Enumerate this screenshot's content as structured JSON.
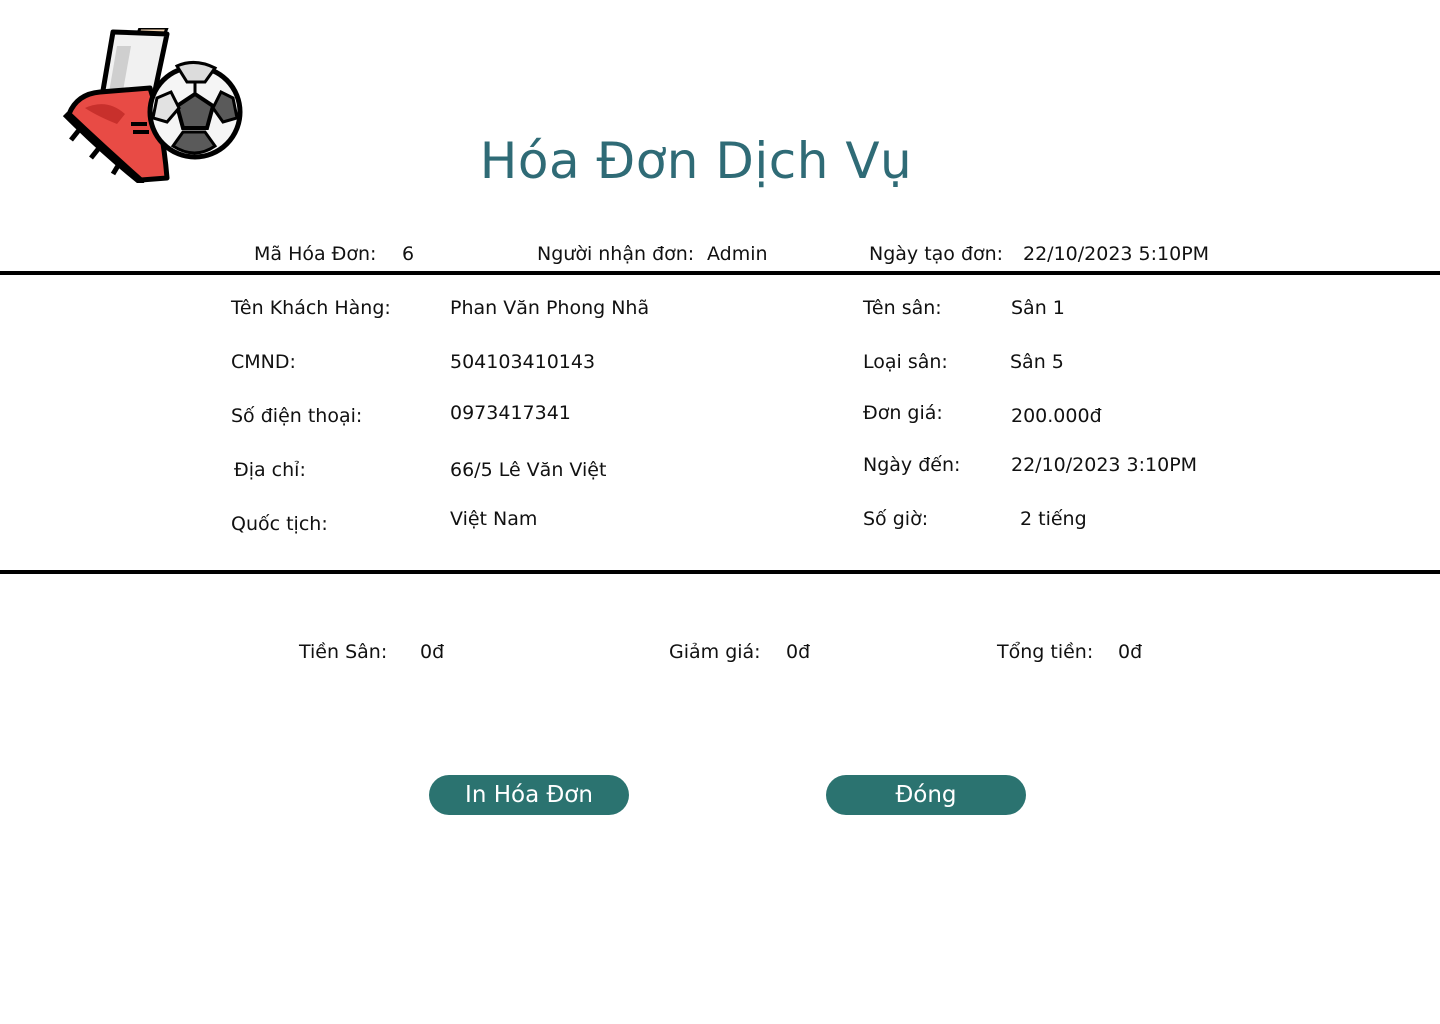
{
  "page": {
    "title": "Hóa Đơn Dịch Vụ",
    "accent_color": "#2f6b76",
    "button_color": "#2b7370",
    "logo_icon": "football-kick-icon"
  },
  "header": {
    "invoice_id_label": "Mã Hóa Đơn:",
    "invoice_id_value": "6",
    "receiver_label": "Người nhận đơn:",
    "receiver_value": "Admin",
    "created_label": "Ngày tạo đơn:",
    "created_value": "22/10/2023 5:10PM"
  },
  "customer": {
    "name_label": "Tên Khách Hàng:",
    "name_value": "Phan Văn Phong Nhã",
    "id_label": "CMND:",
    "id_value": "504103410143",
    "phone_label": "Số điện thoại:",
    "phone_value": "0973417341",
    "address_label": "Địa chỉ:",
    "address_value": "66/5 Lê Văn Việt",
    "nationality_label": "Quốc tịch:",
    "nationality_value": "Việt Nam"
  },
  "field": {
    "name_label": "Tên sân:",
    "name_value": "Sân 1",
    "type_label": "Loại sân:",
    "type_value": "Sân 5",
    "price_label": "Đơn giá:",
    "price_value": "200.000đ",
    "arrival_label": "Ngày đến:",
    "arrival_value": "22/10/2023 3:10PM",
    "hours_label": "Số giờ:",
    "hours_value": "2 tiếng"
  },
  "totals": {
    "field_fee_label": "Tiền Sân:",
    "field_fee_value": "0đ",
    "discount_label": "Giảm giá:",
    "discount_value": "0đ",
    "total_label": "Tổng tiền:",
    "total_value": "0đ"
  },
  "actions": {
    "print_label": "In Hóa Đơn",
    "close_label": "Đóng"
  }
}
